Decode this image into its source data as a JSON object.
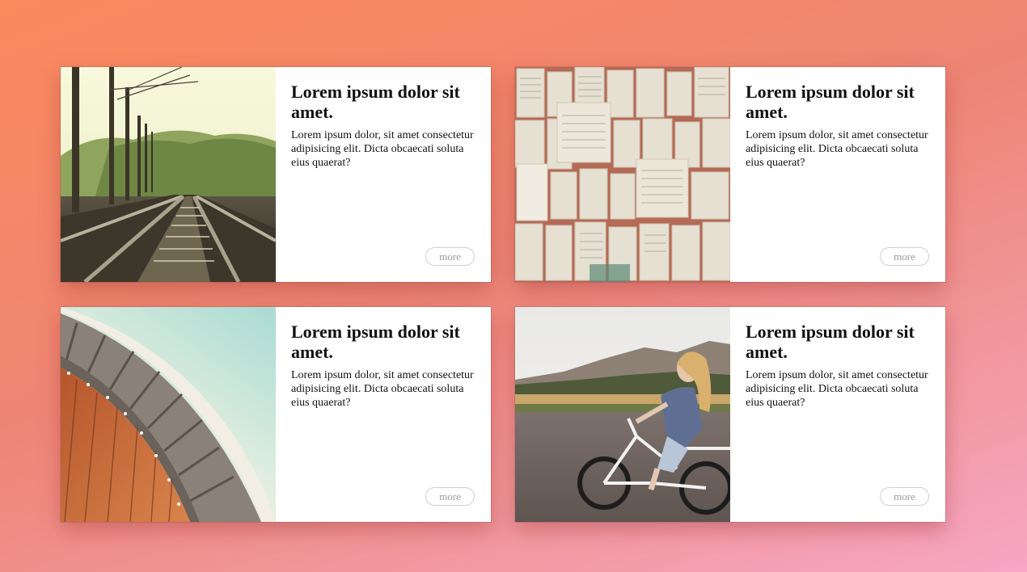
{
  "cards": [
    {
      "title": "Lorem ipsum dolor sit amet.",
      "text": "Lorem ipsum dolor, sit amet consectetur adipisicing elit. Dicta obcaecati soluta eius quaerat?",
      "button_label": "more",
      "image": "railway-tracks-photo"
    },
    {
      "title": "Lorem ipsum dolor sit amet.",
      "text": "Lorem ipsum dolor, sit amet consectetur adipisicing elit. Dicta obcaecati soluta eius quaerat?",
      "button_label": "more",
      "image": "open-books-photo"
    },
    {
      "title": "Lorem ipsum dolor sit amet.",
      "text": "Lorem ipsum dolor, sit amet consectetur adipisicing elit. Dicta obcaecati soluta eius quaerat?",
      "button_label": "more",
      "image": "curved-architecture-photo"
    },
    {
      "title": "Lorem ipsum dolor sit amet.",
      "text": "Lorem ipsum dolor, sit amet consectetur adipisicing elit. Dicta obcaecati soluta eius quaerat?",
      "button_label": "more",
      "image": "woman-on-bicycle-photo"
    }
  ],
  "colors": {
    "background_start": "#fb8a5c",
    "background_end": "#f7a6c4",
    "card_background": "#ffffff",
    "button_text": "#9a9a9a"
  }
}
